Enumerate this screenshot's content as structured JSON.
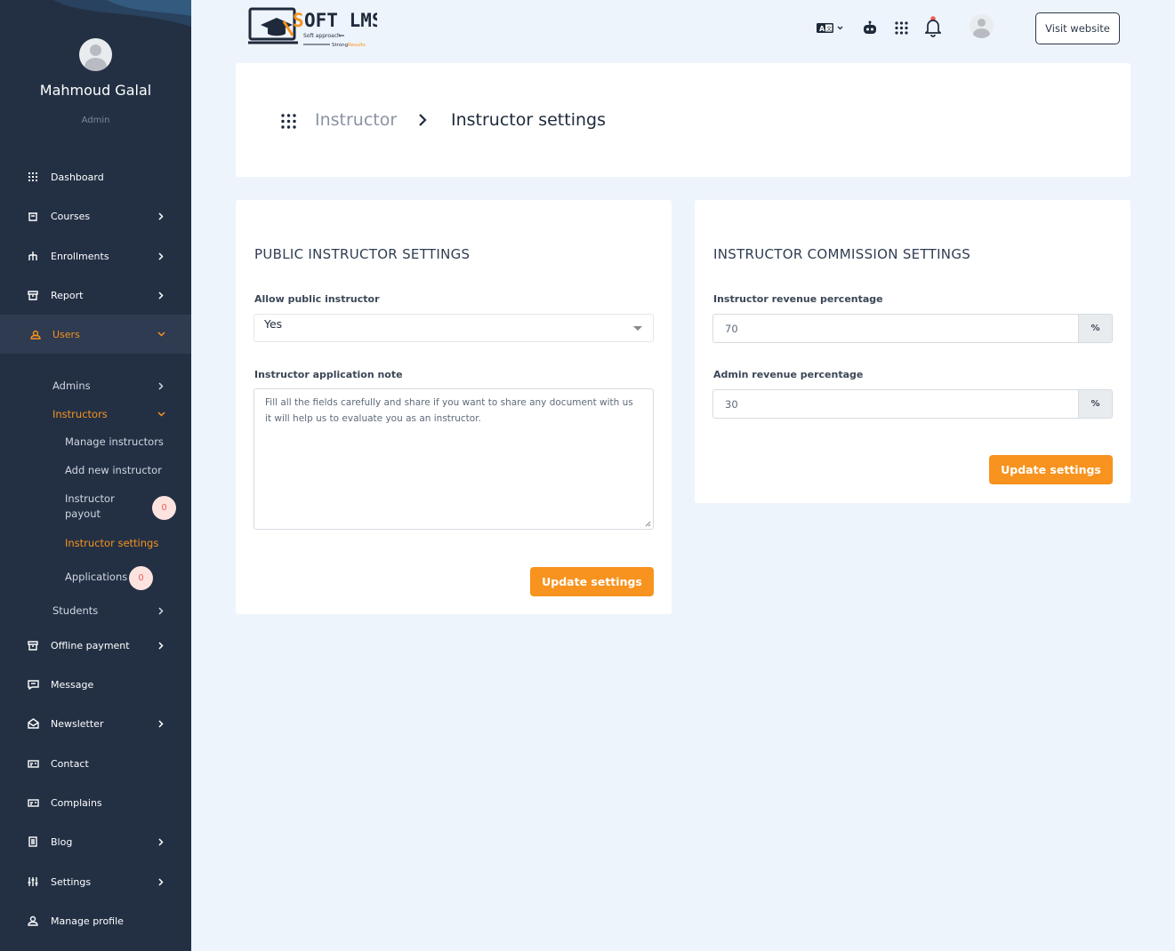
{
  "user": {
    "name": "Mahmoud Galal",
    "role": "Admin"
  },
  "sidebar": {
    "items": [
      {
        "label": "Dashboard",
        "icon": "dashboard-grid-icon"
      },
      {
        "label": "Courses",
        "icon": "courses-icon"
      },
      {
        "label": "Enrollments",
        "icon": "enrollments-icon"
      },
      {
        "label": "Report",
        "icon": "report-icon"
      },
      {
        "label": "Users",
        "icon": "users-icon"
      },
      {
        "label": "Offline payment",
        "icon": "offline-payment-icon"
      },
      {
        "label": "Message",
        "icon": "message-icon"
      },
      {
        "label": "Newsletter",
        "icon": "newsletter-icon"
      },
      {
        "label": "Contact",
        "icon": "contact-icon"
      },
      {
        "label": "Complains",
        "icon": "complains-icon"
      },
      {
        "label": "Blog",
        "icon": "blog-icon"
      },
      {
        "label": "Settings",
        "icon": "settings-sliders-icon"
      },
      {
        "label": "Manage profile",
        "icon": "profile-icon"
      }
    ],
    "users_sub": {
      "admins": "Admins",
      "instructors": "Instructors",
      "manage_instructors": "Manage instructors",
      "add_new_instructor": "Add new instructor",
      "instructor_payout_line1": "Instructor",
      "instructor_payout_line2": "payout",
      "instructor_payout_count": "0",
      "instructor_settings": "Instructor settings",
      "applications": "Applications",
      "applications_count": "0",
      "students": "Students"
    }
  },
  "header": {
    "logo": {
      "brand": "SOFT LMS",
      "tagline_1": "Soft approach",
      "tagline_2": "Strong",
      "tagline_3": "Results"
    },
    "visit_website": "Visit website"
  },
  "breadcrumb": {
    "parent": "Instructor",
    "current": "Instructor settings"
  },
  "public_settings": {
    "title": "PUBLIC INSTRUCTOR SETTINGS",
    "allow_label": "Allow public instructor",
    "allow_value": "Yes",
    "note_label": "Instructor application note",
    "note_value": "Fill all the fields carefully and share if you want to share any document with us it will help us to evaluate you as an instructor.",
    "button": "Update settings"
  },
  "commission_settings": {
    "title": "INSTRUCTOR COMMISSION SETTINGS",
    "instructor_label": "Instructor revenue percentage",
    "instructor_value": "70",
    "admin_label": "Admin revenue percentage",
    "admin_value": "30",
    "addon": "%",
    "button": "Update settings"
  },
  "colors": {
    "sidebar_bg": "#233044",
    "accent": "#f7931e",
    "page_bg": "#eef4fb"
  }
}
